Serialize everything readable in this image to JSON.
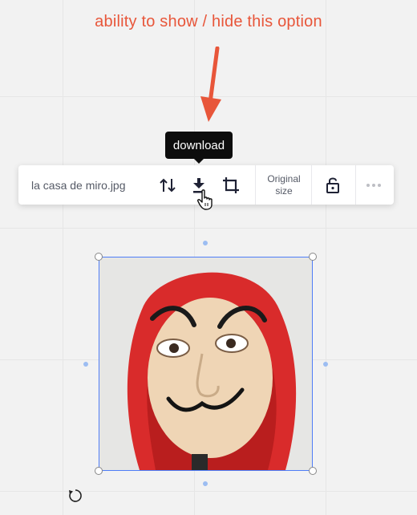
{
  "annotation": {
    "text": "ability to show / hide this option",
    "color": "#e8563a"
  },
  "tooltip": {
    "text": "download"
  },
  "toolbar": {
    "filename": "la casa de miro.jpg",
    "original_size_line1": "Original",
    "original_size_line2": "size",
    "icons": [
      "swap-icon",
      "download-icon",
      "crop-icon",
      "unlock-icon",
      "more-icon"
    ]
  },
  "colors": {
    "selection": "#4f7df7",
    "annotation": "#e8563a",
    "hood": "#d92b2b"
  }
}
